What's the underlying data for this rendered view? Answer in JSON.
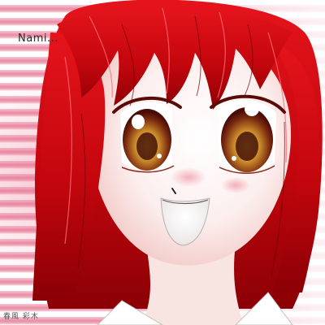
{
  "caption": "Nami...",
  "signature": "春風 彩木",
  "colors": {
    "hair": "#d10a12",
    "hair_dark": "#8c0006",
    "skin": "#fbe9e6",
    "eye_iris": "#d9a23a",
    "background_stripe": "#e98ba3"
  }
}
